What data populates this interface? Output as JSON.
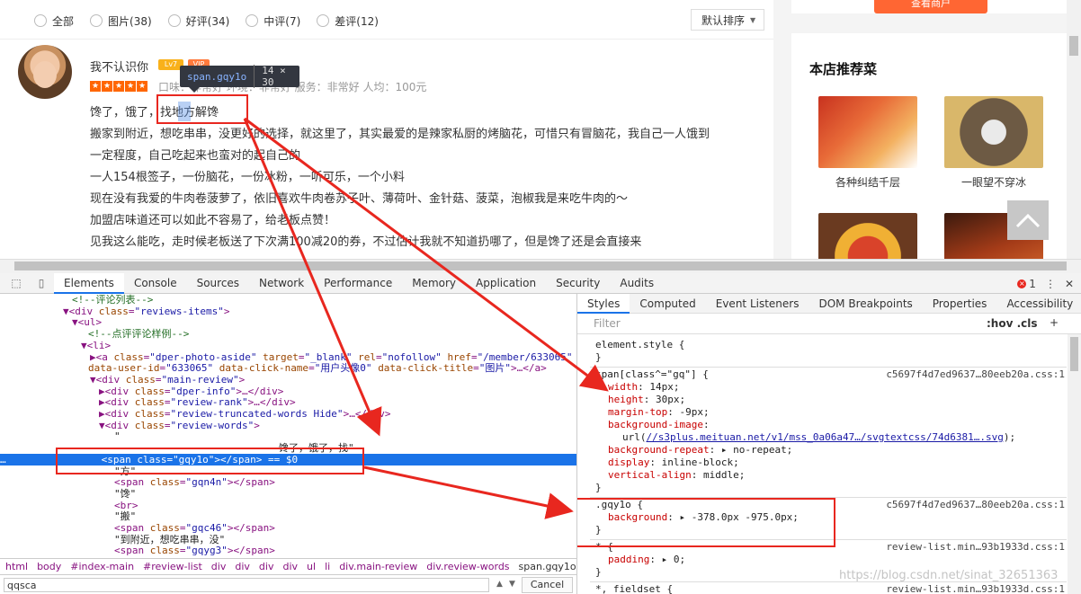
{
  "filter": {
    "options": [
      "全部",
      "图片(38)",
      "好评(34)",
      "中评(7)",
      "差评(12)"
    ],
    "sort_label": "默认排序"
  },
  "review": {
    "username": "我不认识你",
    "level_badge": "Lv7",
    "vip_badge": "VIP",
    "rating_stars": 5,
    "rank_text": "口味：非常好  环境：非常好  服务：非常好  人均：100元",
    "lines": [
      "馋了，饿了，找地方解馋",
      "搬家到附近，想吃串串，没更好的选择，就这里了，其实最爱的是辣家私厨的烤脑花，可惜只有冒脑花，我自己一人饿到",
      "一定程度，自己吃起来也蛮对的起自己的",
      "一人154根签子，一份脑花，一份冰粉，一听可乐，一个小料",
      "现在没有我爱的牛肉卷菠萝了，依旧喜欢牛肉卷苏子叶、薄荷叶、金针菇、菠菜，泡椒我是来吃牛肉的～",
      "加盟店味道还可以如此不容易了，给老板点赞！",
      "见我这么能吃，走时候老板送了下次满100减20的券，不过估计我就不知道扔哪了，但是馋了还是会直接来"
    ]
  },
  "tooltip": {
    "selector": "span.gqy1o",
    "size": "14 × 30"
  },
  "sidebar": {
    "button_label": "查看商户",
    "title": "本店推荐菜",
    "dishes": [
      "各种纠结千层",
      "一眼望不穿冰"
    ]
  },
  "devtools": {
    "tabs": [
      "Elements",
      "Console",
      "Sources",
      "Network",
      "Performance",
      "Memory",
      "Application",
      "Security",
      "Audits"
    ],
    "error_count": "1",
    "styles_tabs": [
      "Styles",
      "Computed",
      "Event Listeners",
      "DOM Breakpoints",
      "Properties",
      "Accessibility"
    ],
    "filter_placeholder": "Filter",
    "hov_cls": ":hov  .cls",
    "dom_lines": [
      {
        "indent": 80,
        "html": "<span class='cm'>&lt;!--评论列表--&gt;</span>"
      },
      {
        "indent": 70,
        "html": "▼<span class='tg'>&lt;div</span> <span class='an'>class</span>=<span class='av'>\"reviews-items\"</span><span class='tg'>&gt;</span>"
      },
      {
        "indent": 80,
        "html": "▼<span class='tg'>&lt;ul&gt;</span>"
      },
      {
        "indent": 98,
        "html": "<span class='cm'>&lt;!--点评评论样例--&gt;</span>"
      },
      {
        "indent": 90,
        "html": "▼<span class='tg'>&lt;li&gt;</span>"
      },
      {
        "indent": 100,
        "html": "▶<span class='tg'>&lt;a</span> <span class='an'>class</span>=<span class='av'>\"dper-photo-aside\"</span> <span class='an'>target</span>=<span class='av'>\"_blank\"</span> <span class='an'>rel</span>=<span class='av'>\"nofollow\"</span> <span class='an'>href</span>=<span class='av'>\"/member/633065\"</span>"
      },
      {
        "indent": 98,
        "html": "<span class='an'>data-user-id</span>=<span class='av'>\"633065\"</span> <span class='an'>data-click-name</span>=<span class='av'>\"用户头像0\"</span> <span class='an'>data-click-title</span>=<span class='av'>\"图片\"</span><span class='tg'>&gt;</span>…<span class='tg'>&lt;/a&gt;</span>"
      },
      {
        "indent": 100,
        "html": "▼<span class='tg'>&lt;div</span> <span class='an'>class</span>=<span class='av'>\"main-review\"</span><span class='tg'>&gt;</span>"
      },
      {
        "indent": 110,
        "html": "▶<span class='tg'>&lt;div</span> <span class='an'>class</span>=<span class='av'>\"dper-info\"</span><span class='tg'>&gt;</span>…<span class='tg'>&lt;/div&gt;</span>"
      },
      {
        "indent": 110,
        "html": "▶<span class='tg'>&lt;div</span> <span class='an'>class</span>=<span class='av'>\"review-rank\"</span><span class='tg'>&gt;</span>…<span class='tg'>&lt;/div&gt;</span>"
      },
      {
        "indent": 110,
        "html": "▶<span class='tg'>&lt;div</span> <span class='an'>class</span>=<span class='av'>\"review-truncated-words Hide\"</span><span class='tg'>&gt;</span>…<span class='tg'>&lt;/div&gt;</span>"
      },
      {
        "indent": 110,
        "html": "▼<span class='tg'>&lt;div</span> <span class='an'>class</span>=<span class='av'>\"review-words\"</span><span class='tg'>&gt;</span>"
      },
      {
        "indent": 127,
        "html": "<span class='tx'>\"</span>"
      },
      {
        "indent": 310,
        "html": "<span class='tx'>馋了，饿了，找\"</span>"
      },
      {
        "indent": 0,
        "html": "<span style='color:#fff'>…</span>                <span>&lt;span class=\"gqy1o\"&gt;&lt;/span&gt; == $0</span>",
        "selected": true
      },
      {
        "indent": 127,
        "html": "<span class='tx'>\"方\"</span>"
      },
      {
        "indent": 127,
        "html": "<span class='tg'>&lt;span</span> <span class='an'>class</span>=<span class='av'>\"gqn4n\"</span><span class='tg'>&gt;&lt;/span&gt;</span>"
      },
      {
        "indent": 127,
        "html": "<span class='tx'>\"馋\"</span>"
      },
      {
        "indent": 127,
        "html": "<span class='tg'>&lt;br&gt;</span>"
      },
      {
        "indent": 127,
        "html": "<span class='tx'>\"搬\"</span>"
      },
      {
        "indent": 127,
        "html": "<span class='tg'>&lt;span</span> <span class='an'>class</span>=<span class='av'>\"gqc46\"</span><span class='tg'>&gt;&lt;/span&gt;</span>"
      },
      {
        "indent": 127,
        "html": "<span class='tx'>\"到附近，想吃串串，没\"</span>"
      },
      {
        "indent": 127,
        "html": "<span class='tg'>&lt;span</span> <span class='an'>class</span>=<span class='av'>\"gqyg3\"</span><span class='tg'>&gt;&lt;/span&gt;</span>"
      }
    ],
    "breadcrumb": [
      "html",
      "body",
      "#index-main",
      "#review-list",
      "div",
      "div",
      "div",
      "div",
      "ul",
      "li",
      "div.main-review",
      "div.review-words",
      "span.gqy1o"
    ],
    "search_value": "qqsca",
    "cancel_label": "Cancel",
    "style_lines": [
      {
        "x": 20,
        "html": "element.style {"
      },
      {
        "x": 20,
        "html": "}"
      },
      {
        "x": 20,
        "html": "span[class^=\"gq\"] {",
        "src": "c5697f4d7ed9637…80eeb20a.css:1"
      },
      {
        "x": 34,
        "html": "<span class='pn'>width</span>: <span class='pv'>14px;</span>"
      },
      {
        "x": 34,
        "html": "<span class='pn'>height</span>: <span class='pv'>30px;</span>"
      },
      {
        "x": 34,
        "html": "<span class='pn'>margin-top</span>: <span class='pv'>-9px;</span>"
      },
      {
        "x": 34,
        "html": "<span class='pn'>background-image</span>:"
      },
      {
        "x": 50,
        "html": "url(<span class='lk'>//s3plus.meituan.net/v1/mss_0a06a47…/svgtextcss/74d6381….svg</span>);"
      },
      {
        "x": 34,
        "html": "<span class='pn'>background-repeat</span>: ▸ no-repeat;"
      },
      {
        "x": 34,
        "html": "<span class='pn'>display</span>: inline-block;"
      },
      {
        "x": 34,
        "html": "<span class='pn'>vertical-align</span>: middle;"
      },
      {
        "x": 20,
        "html": "}"
      },
      {
        "x": 20,
        "html": ".gqy1o {",
        "src": "c5697f4d7ed9637…80eeb20a.css:1"
      },
      {
        "x": 34,
        "html": "<span class='pn'>background</span>: ▸ -378.0px -975.0px;"
      },
      {
        "x": 20,
        "html": "}"
      },
      {
        "x": 20,
        "html": "* {",
        "src": "review-list.min…93b1933d.css:1"
      },
      {
        "x": 34,
        "html": "<span class='pn'>padding</span>: ▸ 0;"
      },
      {
        "x": 20,
        "html": "}"
      },
      {
        "x": 20,
        "html": "*, fieldset {",
        "src": "review-list.min…93b1933d.css:1"
      }
    ]
  },
  "watermark": "https://blog.csdn.net/sinat_32651363",
  "colors": {
    "accent": "#ff6600",
    "annotation_red": "#e8271f",
    "devtools_select": "#1a73e8"
  }
}
